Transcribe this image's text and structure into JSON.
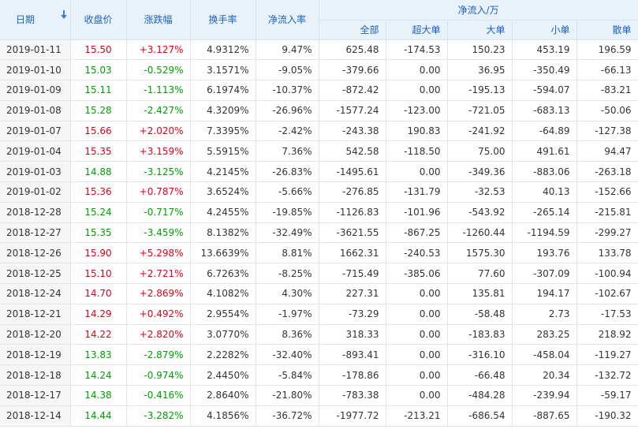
{
  "header": {
    "date": "日期",
    "close": "收盘价",
    "change": "涨跌幅",
    "turnover": "换手率",
    "net_rate": "净流入率",
    "net_group": "净流入/万",
    "sub": [
      "全部",
      "超大单",
      "大单",
      "小单",
      "散单"
    ]
  },
  "colors": {
    "up": "#e3001b",
    "down": "#00a000",
    "header_text": "#1a63b7"
  },
  "rows": [
    {
      "date": "2019-01-11",
      "close": "15.50",
      "change": "+3.127%",
      "turnover": "4.9312%",
      "rate": "9.47%",
      "all": "625.48",
      "xl": "-174.53",
      "l": "150.23",
      "s": "453.19",
      "r": "196.59",
      "dir": "up"
    },
    {
      "date": "2019-01-10",
      "close": "15.03",
      "change": "-0.529%",
      "turnover": "3.1571%",
      "rate": "-9.05%",
      "all": "-379.66",
      "xl": "0.00",
      "l": "36.95",
      "s": "-350.49",
      "r": "-66.13",
      "dir": "dn"
    },
    {
      "date": "2019-01-09",
      "close": "15.11",
      "change": "-1.113%",
      "turnover": "6.1974%",
      "rate": "-10.37%",
      "all": "-872.42",
      "xl": "0.00",
      "l": "-195.13",
      "s": "-594.07",
      "r": "-83.21",
      "dir": "dn"
    },
    {
      "date": "2019-01-08",
      "close": "15.28",
      "change": "-2.427%",
      "turnover": "4.3209%",
      "rate": "-26.96%",
      "all": "-1577.24",
      "xl": "-123.00",
      "l": "-721.05",
      "s": "-683.13",
      "r": "-50.06",
      "dir": "dn"
    },
    {
      "date": "2019-01-07",
      "close": "15.66",
      "change": "+2.020%",
      "turnover": "7.3395%",
      "rate": "-2.42%",
      "all": "-243.38",
      "xl": "190.83",
      "l": "-241.92",
      "s": "-64.89",
      "r": "-127.38",
      "dir": "up"
    },
    {
      "date": "2019-01-04",
      "close": "15.35",
      "change": "+3.159%",
      "turnover": "5.5915%",
      "rate": "7.36%",
      "all": "542.58",
      "xl": "-118.50",
      "l": "75.00",
      "s": "491.61",
      "r": "94.47",
      "dir": "up"
    },
    {
      "date": "2019-01-03",
      "close": "14.88",
      "change": "-3.125%",
      "turnover": "4.2145%",
      "rate": "-26.83%",
      "all": "-1495.61",
      "xl": "0.00",
      "l": "-349.36",
      "s": "-883.06",
      "r": "-263.18",
      "dir": "dn"
    },
    {
      "date": "2019-01-02",
      "close": "15.36",
      "change": "+0.787%",
      "turnover": "3.6524%",
      "rate": "-5.66%",
      "all": "-276.85",
      "xl": "-131.79",
      "l": "-32.53",
      "s": "40.13",
      "r": "-152.66",
      "dir": "up"
    },
    {
      "date": "2018-12-28",
      "close": "15.24",
      "change": "-0.717%",
      "turnover": "4.2455%",
      "rate": "-19.85%",
      "all": "-1126.83",
      "xl": "-101.96",
      "l": "-543.92",
      "s": "-265.14",
      "r": "-215.81",
      "dir": "dn"
    },
    {
      "date": "2018-12-27",
      "close": "15.35",
      "change": "-3.459%",
      "turnover": "8.1382%",
      "rate": "-32.49%",
      "all": "-3621.55",
      "xl": "-867.25",
      "l": "-1260.44",
      "s": "-1194.59",
      "r": "-299.27",
      "dir": "dn"
    },
    {
      "date": "2018-12-26",
      "close": "15.90",
      "change": "+5.298%",
      "turnover": "13.6639%",
      "rate": "8.81%",
      "all": "1662.31",
      "xl": "-240.53",
      "l": "1575.30",
      "s": "193.76",
      "r": "133.78",
      "dir": "up"
    },
    {
      "date": "2018-12-25",
      "close": "15.10",
      "change": "+2.721%",
      "turnover": "6.7263%",
      "rate": "-8.25%",
      "all": "-715.49",
      "xl": "-385.06",
      "l": "77.60",
      "s": "-307.09",
      "r": "-100.94",
      "dir": "up"
    },
    {
      "date": "2018-12-24",
      "close": "14.70",
      "change": "+2.869%",
      "turnover": "4.1082%",
      "rate": "4.30%",
      "all": "227.31",
      "xl": "0.00",
      "l": "135.81",
      "s": "194.17",
      "r": "-102.67",
      "dir": "up"
    },
    {
      "date": "2018-12-21",
      "close": "14.29",
      "change": "+0.492%",
      "turnover": "2.9554%",
      "rate": "-1.97%",
      "all": "-73.29",
      "xl": "0.00",
      "l": "-58.48",
      "s": "2.73",
      "r": "-17.53",
      "dir": "up"
    },
    {
      "date": "2018-12-20",
      "close": "14.22",
      "change": "+2.820%",
      "turnover": "3.0770%",
      "rate": "8.36%",
      "all": "318.33",
      "xl": "0.00",
      "l": "-183.83",
      "s": "283.25",
      "r": "218.92",
      "dir": "up"
    },
    {
      "date": "2018-12-19",
      "close": "13.83",
      "change": "-2.879%",
      "turnover": "2.2282%",
      "rate": "-32.40%",
      "all": "-893.41",
      "xl": "0.00",
      "l": "-316.10",
      "s": "-458.04",
      "r": "-119.27",
      "dir": "dn"
    },
    {
      "date": "2018-12-18",
      "close": "14.24",
      "change": "-0.974%",
      "turnover": "2.4450%",
      "rate": "-5.84%",
      "all": "-178.86",
      "xl": "0.00",
      "l": "-66.48",
      "s": "20.34",
      "r": "-132.72",
      "dir": "dn"
    },
    {
      "date": "2018-12-17",
      "close": "14.38",
      "change": "-0.416%",
      "turnover": "2.8640%",
      "rate": "-21.80%",
      "all": "-783.38",
      "xl": "0.00",
      "l": "-484.28",
      "s": "-239.94",
      "r": "-59.17",
      "dir": "dn"
    },
    {
      "date": "2018-12-14",
      "close": "14.44",
      "change": "-3.282%",
      "turnover": "4.1856%",
      "rate": "-36.72%",
      "all": "-1977.72",
      "xl": "-213.21",
      "l": "-686.54",
      "s": "-887.65",
      "r": "-190.32",
      "dir": "dn"
    }
  ]
}
